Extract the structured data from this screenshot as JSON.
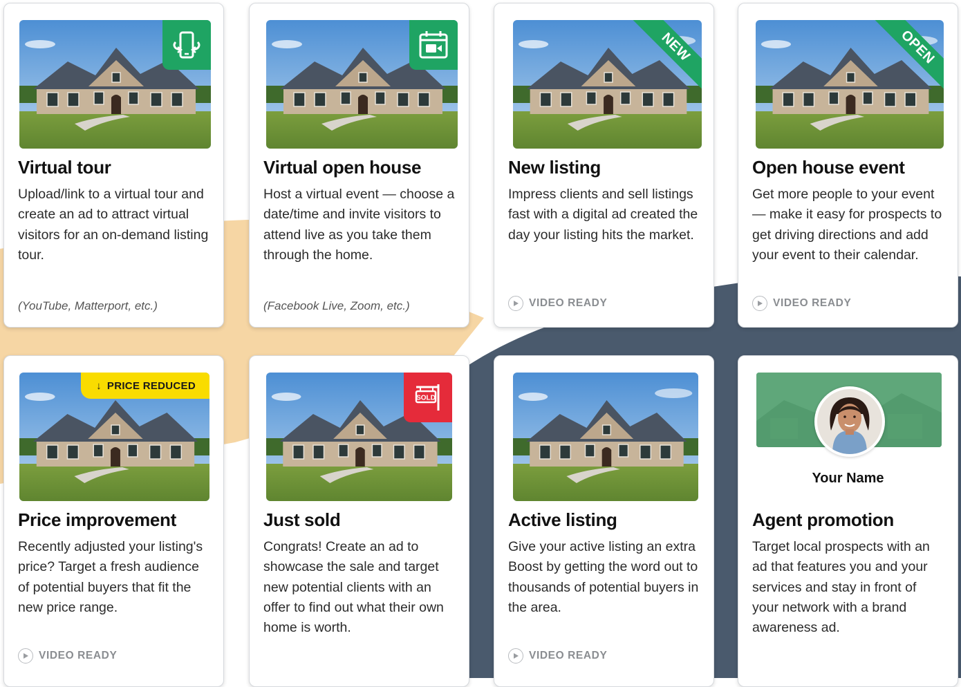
{
  "colors": {
    "peach": "#f6d6a4",
    "navy": "#4a5a6d",
    "green": "#1fa463",
    "yellow": "#f9dc00",
    "red": "#e52b3a"
  },
  "cards": [
    {
      "title": "Virtual tour",
      "desc": "Upload/link to a virtual tour and create an ad to attract virtual visitors for an on-demand listing tour.",
      "note": "(YouTube, Matterport, etc.)",
      "badge": "phone-rotate-icon"
    },
    {
      "title": "Virtual open house",
      "desc": "Host a virtual event — choose a date/time and invite visitors to attend live as you take them through the home.",
      "note": "(Facebook Live, Zoom, etc.)",
      "badge": "calendar-video-icon"
    },
    {
      "title": "New listing",
      "desc": "Impress clients and sell listings fast with a digital ad created the day your listing hits the market.",
      "ribbon": "NEW",
      "video": "VIDEO READY"
    },
    {
      "title": "Open house event",
      "desc": "Get more people to your event — make it easy for prospects to get driving directions and add your event to their calendar.",
      "ribbon": "OPEN",
      "video": "VIDEO READY"
    },
    {
      "title": "Price improvement",
      "desc": "Recently adjusted your listing's price? Target a fresh audience of potential buyers that fit the new price range.",
      "price_badge": "PRICE REDUCED",
      "video": "VIDEO READY"
    },
    {
      "title": "Just sold",
      "desc": "Congrats! Create an ad to showcase the sale and target new potential clients with an offer to find out what their own home is worth.",
      "sold_sign": "SOLD"
    },
    {
      "title": "Active listing",
      "desc": "Give your active listing an extra Boost by getting the word out to thousands of potential buyers in the area.",
      "video": "VIDEO READY"
    },
    {
      "title": "Agent promotion",
      "desc": "Target local prospects with an ad that features you and your services and stay in front of your network with a brand awareness ad.",
      "agent_name": "Your Name"
    }
  ]
}
